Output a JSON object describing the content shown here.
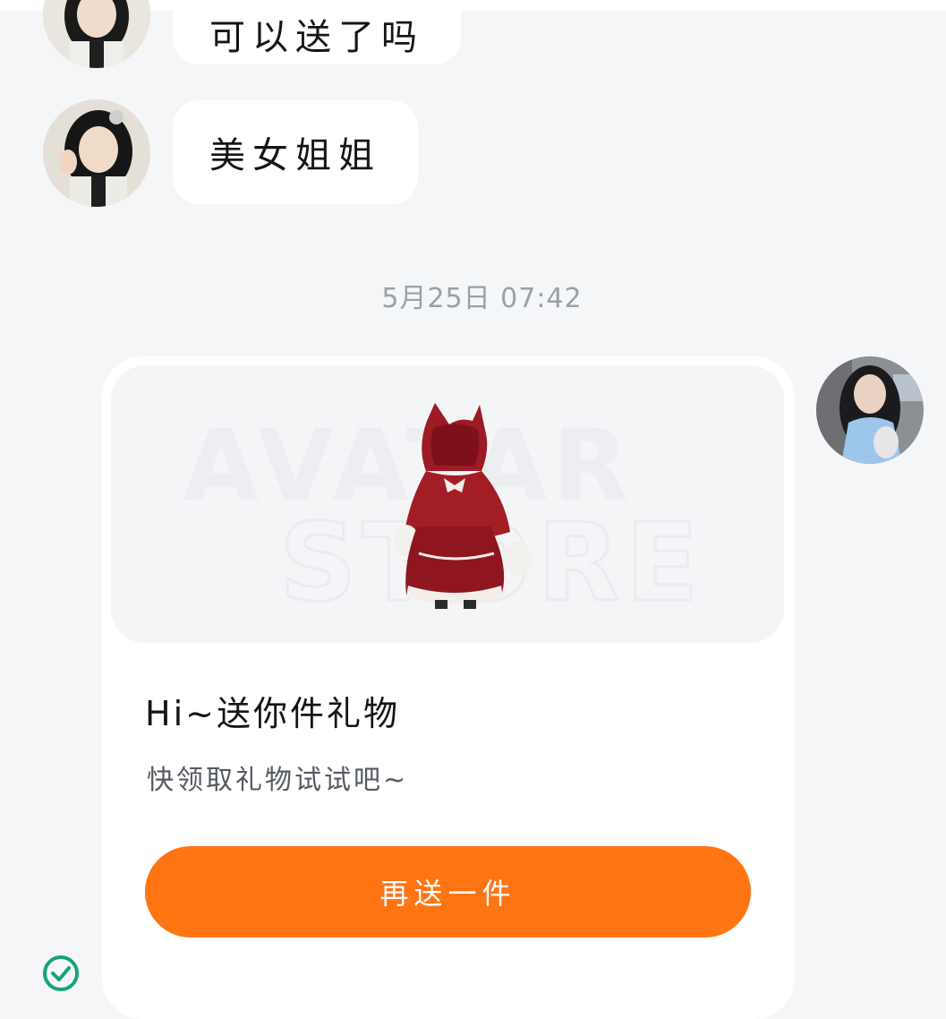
{
  "chat": {
    "messages": [
      {
        "sender": "other",
        "text": "可以送了吗"
      },
      {
        "sender": "other",
        "text": "美女姐姐"
      }
    ],
    "timestamp": "5月25日 07:42",
    "gift_card": {
      "watermark_line1": "AVATAR",
      "watermark_line2": "STORE",
      "title": "Hi~送你件礼物",
      "subtitle": "快领取礼物试试吧~",
      "button_label": "再送一件"
    }
  },
  "icons": {
    "read_status": "check-circle-icon"
  },
  "colors": {
    "background": "#f5f6f8",
    "bubble": "#ffffff",
    "accent_button": "#ff7413",
    "timestamp": "#9aa0a6",
    "check": "#16a37a"
  }
}
